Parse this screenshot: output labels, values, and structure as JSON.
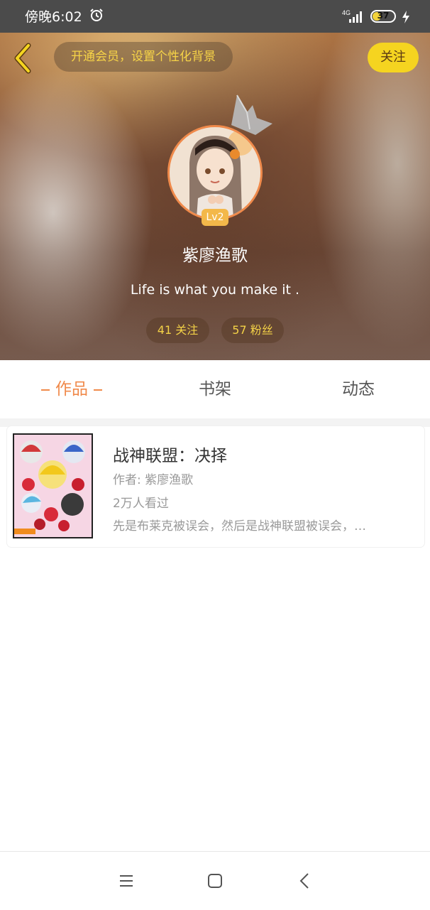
{
  "status_bar": {
    "time": "傍晚6:02",
    "network": "4G",
    "battery": "37",
    "battery_level": 0.37
  },
  "header": {
    "vip_banner": "开通会员，设置个性化背景",
    "follow_label": "关注",
    "level": "Lv2",
    "username": "紫廖渔歌",
    "bio": "Life is what you make it .",
    "following": "41 关注",
    "fans": "57 粉丝"
  },
  "tabs": [
    {
      "label": "作品",
      "active": true
    },
    {
      "label": "书架",
      "active": false
    },
    {
      "label": "动态",
      "active": false
    }
  ],
  "works": [
    {
      "title": "战神联盟：决择",
      "author": "作者: 紫廖渔歌",
      "views": "2万人看过",
      "summary": "先是布莱克被误会，然后是战神联盟被误会，…"
    }
  ],
  "colors": {
    "accent": "#f08a4b",
    "follow_button": "#f5d420",
    "banner_text": "#f7d447"
  },
  "icons": {
    "back": "chevron-left-icon",
    "alarm": "alarm-icon",
    "crown": "crown-icon",
    "menu": "menu-icon",
    "home": "home-icon",
    "nav_back": "back-icon"
  }
}
